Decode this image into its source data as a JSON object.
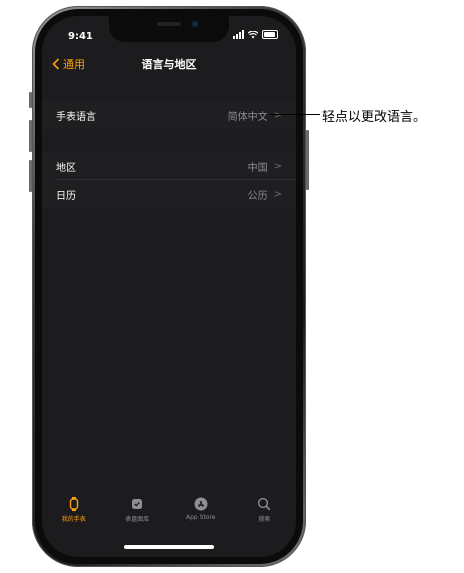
{
  "status": {
    "time": "9:41"
  },
  "nav": {
    "back_label": "通用",
    "title": "语言与地区"
  },
  "settings": {
    "watch_language": {
      "label": "手表语言",
      "value": "简体中文"
    },
    "region": {
      "label": "地区",
      "value": "中国"
    },
    "calendar": {
      "label": "日历",
      "value": "公历"
    }
  },
  "tabbar": {
    "items": [
      {
        "label": "我的手表",
        "icon": "watch-icon",
        "active": true
      },
      {
        "label": "表盘图库",
        "icon": "face-gallery-icon",
        "active": false
      },
      {
        "label": "App Store",
        "icon": "app-store-icon",
        "active": false
      },
      {
        "label": "搜索",
        "icon": "search-icon",
        "active": false
      }
    ]
  },
  "callout": {
    "text": "轻点以更改语言。"
  },
  "colors": {
    "accent": "#ff9f0a",
    "screen_bg": "#1c1c1e",
    "row_bg": "#1f1f21",
    "secondary_text": "#8e8e93"
  }
}
